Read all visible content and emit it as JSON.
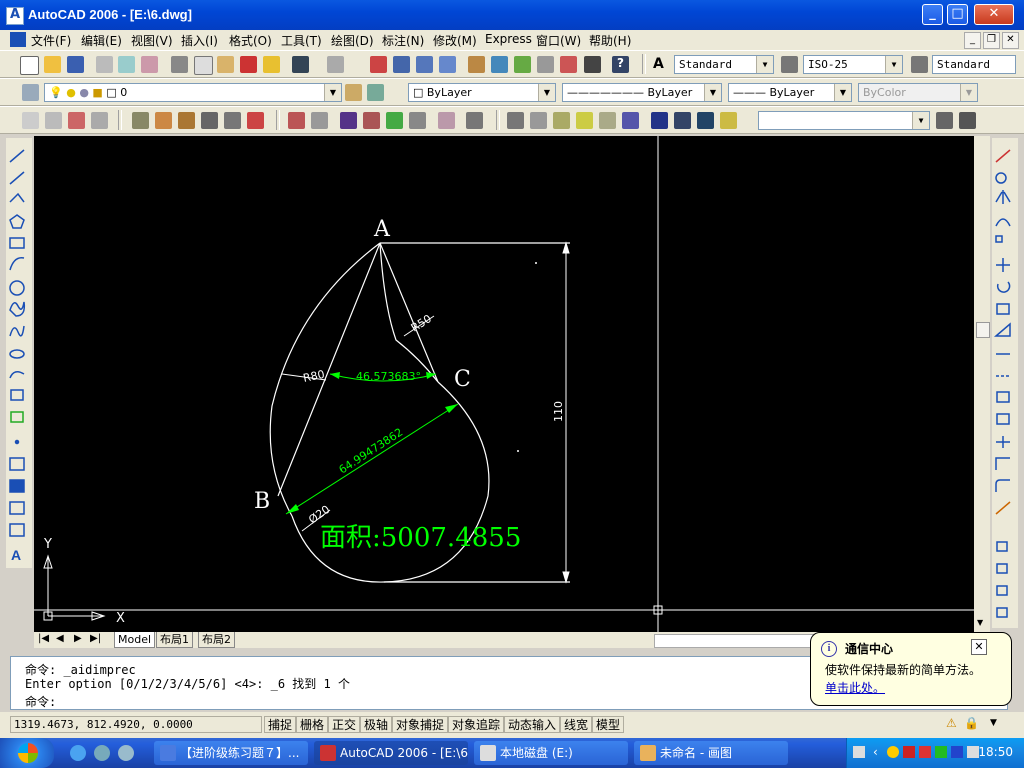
{
  "window": {
    "title": "AutoCAD 2006 - [E:\\6.dwg]"
  },
  "menubar": {
    "items": [
      "文件(F)",
      "编辑(E)",
      "视图(V)",
      "插入(I)",
      "格式(O)",
      "工具(T)",
      "绘图(D)",
      "标注(N)",
      "修改(M)",
      "Express",
      "窗口(W)",
      "帮助(H)"
    ]
  },
  "toolbar1": {
    "text_style": "Standard",
    "dim_style": "ISO-25",
    "table_style": "Standard"
  },
  "toolbar2": {
    "layer": "0",
    "color": "ByLayer",
    "linetype": "ByLayer",
    "lineweight": "ByLayer",
    "plotstyle": "ByColor"
  },
  "toolbar3": {
    "view_combo": ""
  },
  "drawing": {
    "point_a": "A",
    "point_b": "B",
    "point_c": "C",
    "dim_r80": "R80",
    "dim_r50": "R50",
    "dim_angle": "46.573683°",
    "dim_length": "64.99473862",
    "dim_110": "110",
    "dim_phi20": "Ø20",
    "area_text": "面积:5007.4855",
    "ucs_x": "X",
    "ucs_y": "Y"
  },
  "layout_tabs": [
    "Model",
    "布局1",
    "布局2"
  ],
  "command": {
    "line1": "命令: _aidimprec",
    "line2": "Enter option [0/1/2/3/4/5/6] <4>: _6 找到 1 个",
    "line3": "命令:"
  },
  "status": {
    "coords": "1319.4673, 812.4920, 0.0000",
    "buttons": [
      "捕捉",
      "栅格",
      "正交",
      "极轴",
      "对象捕捉",
      "对象追踪",
      "动态输入",
      "线宽",
      "模型"
    ]
  },
  "balloon": {
    "title": "通信中心",
    "body": "使软件保持最新的简单方法。",
    "link": "单击此处。"
  },
  "taskbar": {
    "tasks": [
      "【进阶级练习题７】...",
      "AutoCAD 2006 - [E:\\6...",
      "本地磁盘 (E:)",
      "未命名 - 画图"
    ],
    "clock": "18:50"
  },
  "colors": {
    "canvas": "#000000",
    "geometry": "#ffffff",
    "dimension": "#00ff00",
    "titlebar": "#0a58e0"
  }
}
